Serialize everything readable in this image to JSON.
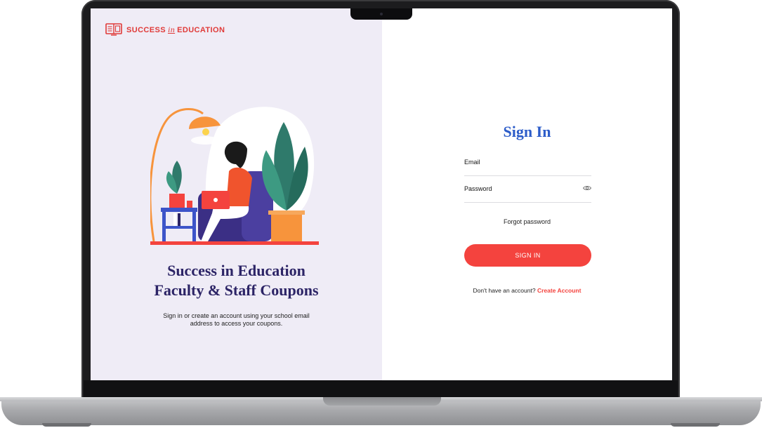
{
  "brand": {
    "pre": "SUCCESS",
    "mid": "in",
    "post": "EDUCATION",
    "color": "#e03a38"
  },
  "left": {
    "headline_line1": "Success in Education",
    "headline_line2": "Faculty & Staff Coupons",
    "subtext": "Sign in or create an account using your school email address to access your coupons."
  },
  "form": {
    "title": "Sign In",
    "email_label": "Email",
    "password_label": "Password",
    "forgot_label": "Forgot password",
    "signin_label": "SIGN IN",
    "no_account_text": "Don't have an account?",
    "create_account_label": "Create Account"
  },
  "colors": {
    "accent": "#f4433e",
    "title_blue": "#2c5cc9",
    "headline_navy": "#2c2466",
    "left_bg": "#efecf6"
  },
  "icons": {
    "brand": "book-logo-icon",
    "password_toggle": "eye-icon"
  }
}
